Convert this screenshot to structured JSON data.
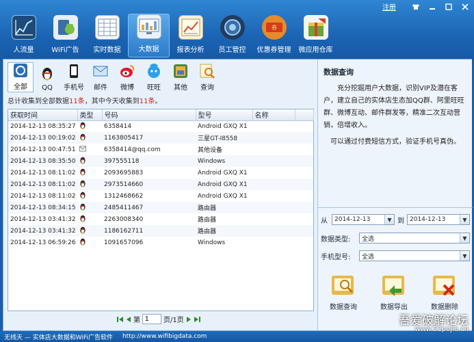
{
  "window": {
    "register_link": "注册",
    "skin_icon": "shirt-icon",
    "min_icon": "minimize-icon",
    "max_icon": "maximize-icon",
    "close_icon": "close-icon"
  },
  "nav": [
    {
      "label": "人流量",
      "color": "#2a5d8f"
    },
    {
      "label": "WiFi广告",
      "color": "#4a8f3a"
    },
    {
      "label": "实时数据",
      "color": "#d8e2ec"
    },
    {
      "label": "大数据",
      "color": "#c9d8e8"
    },
    {
      "label": "报表分析",
      "color": "#e7c26a"
    },
    {
      "label": "员工管控",
      "color": "#2c4f7a"
    },
    {
      "label": "优惠券管理",
      "color": "#e07a2a"
    },
    {
      "label": "微应用仓库",
      "color": "#c44d3a"
    }
  ],
  "filters": [
    {
      "label": "全部"
    },
    {
      "label": "QQ"
    },
    {
      "label": "手机号"
    },
    {
      "label": "邮件"
    },
    {
      "label": "微博"
    },
    {
      "label": "旺旺"
    },
    {
      "label": "其他"
    },
    {
      "label": "查询"
    }
  ],
  "summary": {
    "part1": "总计收集到全部数据",
    "total": "11条",
    "part2": "，其中今天收集到",
    "today": "11条",
    "part3": "。"
  },
  "table": {
    "headers": [
      "获取时间",
      "类型",
      "号码",
      "型号",
      "名称"
    ],
    "rows": [
      {
        "time": "2014-12-13 08:35:27",
        "type": "qq",
        "number": "6358414",
        "model": "Android GXQ X1",
        "name": ""
      },
      {
        "time": "2014-12-13 00:19:02",
        "type": "qq",
        "number": "1163805417",
        "model": "三星GT-I8558",
        "name": ""
      },
      {
        "time": "2014-12-13 00:47:51",
        "type": "mail",
        "number": "6358414@qq.com",
        "model": "其他设备",
        "name": ""
      },
      {
        "time": "2014-12-13 08:35:50",
        "type": "qq",
        "number": "397555118",
        "model": "Windows",
        "name": ""
      },
      {
        "time": "2014-12-13 08:11:02",
        "type": "qq",
        "number": "2093695883",
        "model": "Android GXQ X1",
        "name": ""
      },
      {
        "time": "2014-12-13 08:11:02",
        "type": "qq",
        "number": "2973514660",
        "model": "Android GXQ X1",
        "name": ""
      },
      {
        "time": "2014-12-13 08:11:02",
        "type": "qq",
        "number": "1312468662",
        "model": "Android GXQ X1",
        "name": ""
      },
      {
        "time": "2014-12-13 08:34:15",
        "type": "qq",
        "number": "2485411467",
        "model": "路由器",
        "name": ""
      },
      {
        "time": "2014-12-13 03:41:32",
        "type": "qq",
        "number": "2263008340",
        "model": "路由器",
        "name": ""
      },
      {
        "time": "2014-12-13 03:41:32",
        "type": "qq",
        "number": "1186162711",
        "model": "路由器",
        "name": ""
      },
      {
        "time": "2014-12-13 06:59:26",
        "type": "qq",
        "number": "1091657096",
        "model": "Windows",
        "name": ""
      }
    ]
  },
  "pager": {
    "page_prefix": "第",
    "page_value": "1",
    "page_suffix": "页/1页"
  },
  "panel": {
    "title": "数据查询",
    "text1": "充分挖掘用户大数据，识别VIP及潜在客户，建立自己的实体店生态加QQ群、阿里旺旺群、微博互动、邮件群发等，精准二次互动营销，倍增收入。",
    "text2": "可以通过付费短信方式，验证手机号真伪。",
    "from_label": "从",
    "from_date": "2014-12-13",
    "to_label": "到",
    "to_date": "2014-12-13",
    "data_type_label": "数据类型:",
    "data_type_value": "全选",
    "phone_model_label": "手机型号:",
    "phone_model_value": "全选",
    "actions": [
      {
        "label": "数据查询"
      },
      {
        "label": "数据导出"
      },
      {
        "label": "数据删除"
      }
    ]
  },
  "status": {
    "left": "无线天 — 实体店大数据和WiFi广告软件",
    "url": "http://www.wifibigdata.com"
  },
  "watermark": {
    "line1": "吾爱破解论坛",
    "line2": "www.52pojie.cn"
  }
}
